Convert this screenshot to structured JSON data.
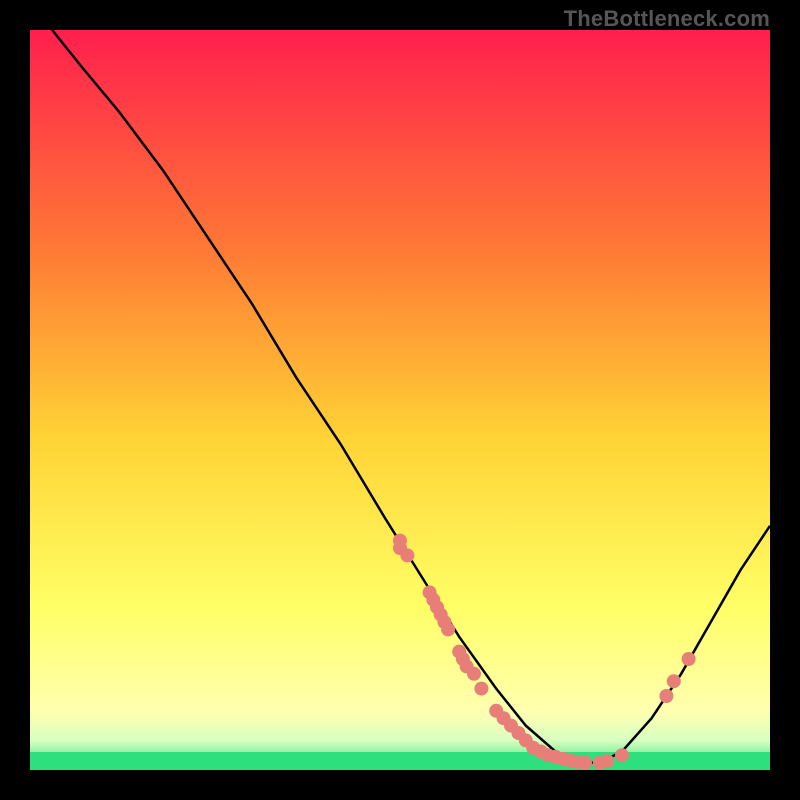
{
  "watermark": "TheBottleneck.com",
  "colors": {
    "curve": "#000000",
    "dots": "#e77f78",
    "green_band": "#2ee07d",
    "gradient_top": "#ff1f4d",
    "gradient_mid1": "#ff7a35",
    "gradient_mid2": "#ffd335",
    "gradient_mid3": "#ffff66",
    "gradient_bottom": "#ffffb0"
  },
  "chart_data": {
    "type": "line",
    "title": "",
    "xlabel": "",
    "ylabel": "",
    "xlim": [
      0,
      100
    ],
    "ylim": [
      0,
      100
    ],
    "curve": [
      {
        "x": 3,
        "y": 100
      },
      {
        "x": 7,
        "y": 95
      },
      {
        "x": 12,
        "y": 89
      },
      {
        "x": 18,
        "y": 81
      },
      {
        "x": 24,
        "y": 72
      },
      {
        "x": 30,
        "y": 63
      },
      {
        "x": 36,
        "y": 53
      },
      {
        "x": 42,
        "y": 44
      },
      {
        "x": 48,
        "y": 34
      },
      {
        "x": 53,
        "y": 26
      },
      {
        "x": 58,
        "y": 18
      },
      {
        "x": 63,
        "y": 11
      },
      {
        "x": 67,
        "y": 6
      },
      {
        "x": 71,
        "y": 2.5
      },
      {
        "x": 74,
        "y": 1
      },
      {
        "x": 77,
        "y": 1
      },
      {
        "x": 80,
        "y": 2.5
      },
      {
        "x": 84,
        "y": 7
      },
      {
        "x": 88,
        "y": 13
      },
      {
        "x": 92,
        "y": 20
      },
      {
        "x": 96,
        "y": 27
      },
      {
        "x": 100,
        "y": 33
      }
    ],
    "dots": [
      {
        "x": 50,
        "y": 31
      },
      {
        "x": 50,
        "y": 30
      },
      {
        "x": 51,
        "y": 29
      },
      {
        "x": 54,
        "y": 24
      },
      {
        "x": 54.5,
        "y": 23
      },
      {
        "x": 55,
        "y": 22
      },
      {
        "x": 55.5,
        "y": 21
      },
      {
        "x": 56,
        "y": 20
      },
      {
        "x": 56.5,
        "y": 19
      },
      {
        "x": 58,
        "y": 16
      },
      {
        "x": 58.5,
        "y": 15
      },
      {
        "x": 59,
        "y": 14
      },
      {
        "x": 60,
        "y": 13
      },
      {
        "x": 61,
        "y": 11
      },
      {
        "x": 63,
        "y": 8
      },
      {
        "x": 64,
        "y": 7
      },
      {
        "x": 65,
        "y": 6
      },
      {
        "x": 66,
        "y": 5
      },
      {
        "x": 67,
        "y": 4
      },
      {
        "x": 68,
        "y": 3
      },
      {
        "x": 69,
        "y": 2.5
      },
      {
        "x": 70,
        "y": 2
      },
      {
        "x": 71,
        "y": 1.8
      },
      {
        "x": 72,
        "y": 1.5
      },
      {
        "x": 73,
        "y": 1.3
      },
      {
        "x": 74,
        "y": 1.1
      },
      {
        "x": 75,
        "y": 1
      },
      {
        "x": 77,
        "y": 1
      },
      {
        "x": 78,
        "y": 1.2
      },
      {
        "x": 80,
        "y": 2
      },
      {
        "x": 86,
        "y": 10
      },
      {
        "x": 87,
        "y": 12
      },
      {
        "x": 89,
        "y": 15
      }
    ]
  }
}
